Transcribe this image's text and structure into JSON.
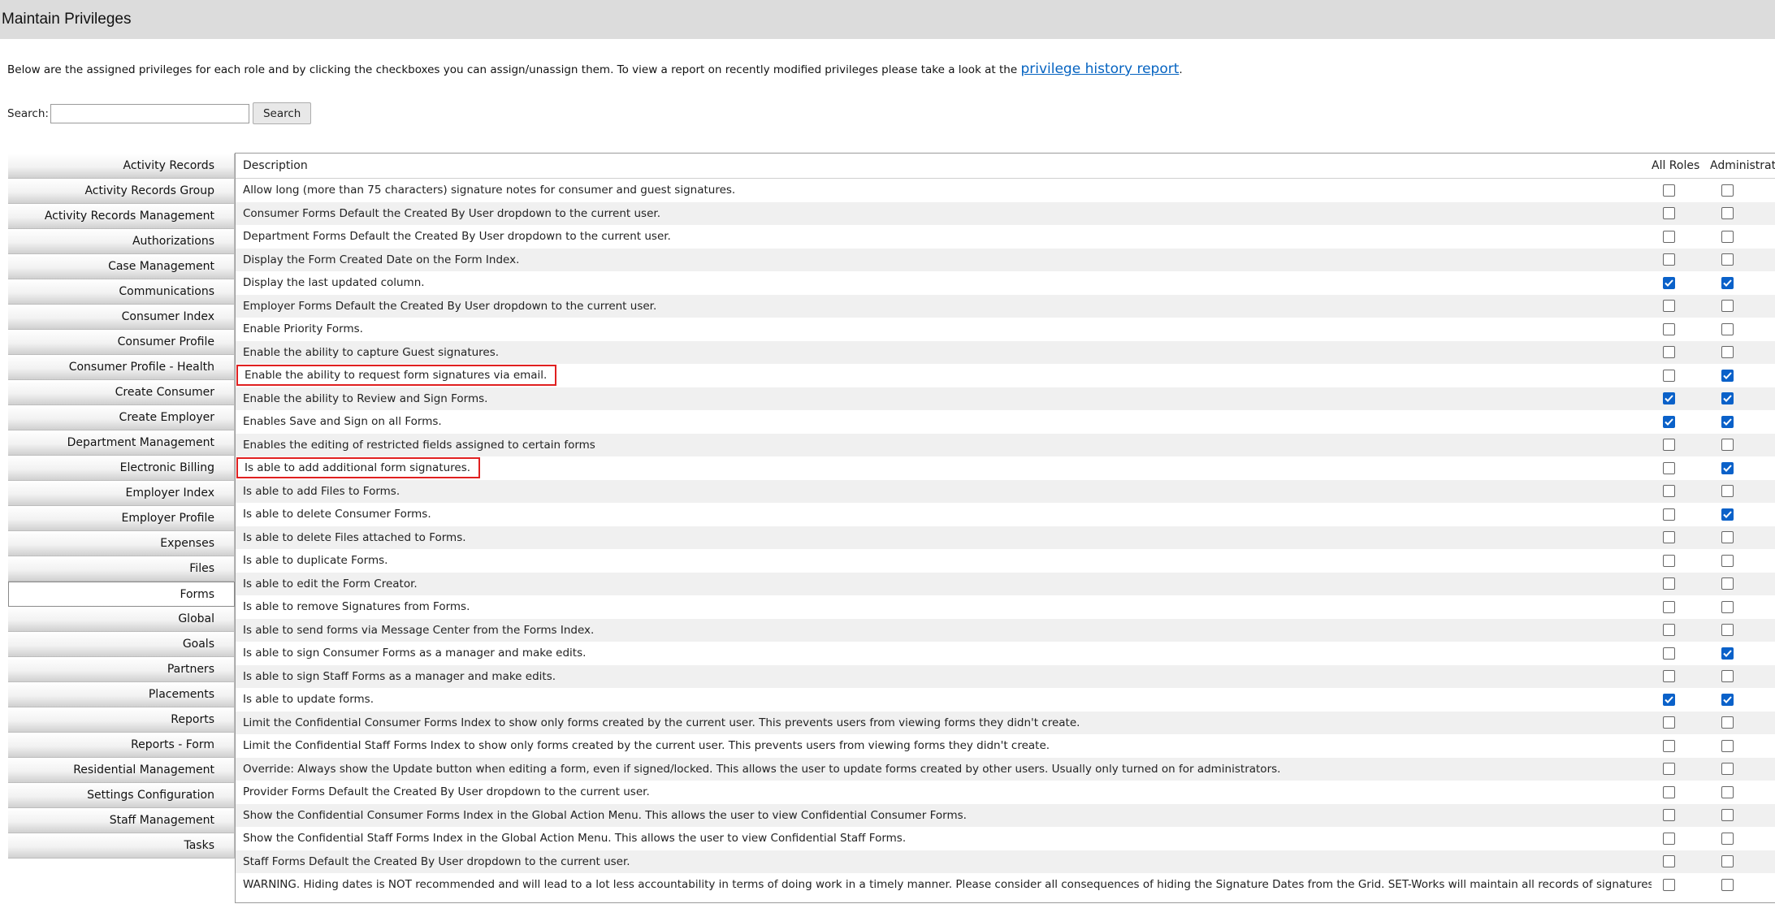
{
  "page": {
    "title": "Maintain Privileges",
    "intro_text": "Below are the assigned privileges for each role and by clicking the checkboxes you can assign/unassign them.   To view a report on recently modified privileges please take a look at the",
    "intro_link": "privilege history report",
    "intro_end": "."
  },
  "search": {
    "label": "Search:",
    "value": "",
    "button": "Search"
  },
  "sidebar": {
    "items": [
      {
        "label": "Activity Records"
      },
      {
        "label": "Activity Records Group"
      },
      {
        "label": "Activity Records Management"
      },
      {
        "label": "Authorizations"
      },
      {
        "label": "Case Management"
      },
      {
        "label": "Communications"
      },
      {
        "label": "Consumer Index"
      },
      {
        "label": "Consumer Profile"
      },
      {
        "label": "Consumer Profile - Health"
      },
      {
        "label": "Create Consumer"
      },
      {
        "label": "Create Employer"
      },
      {
        "label": "Department Management"
      },
      {
        "label": "Electronic Billing"
      },
      {
        "label": "Employer Index"
      },
      {
        "label": "Employer Profile"
      },
      {
        "label": "Expenses"
      },
      {
        "label": "Files"
      },
      {
        "label": "Forms",
        "active": true
      },
      {
        "label": "Global"
      },
      {
        "label": "Goals"
      },
      {
        "label": "Partners"
      },
      {
        "label": "Placements"
      },
      {
        "label": "Reports"
      },
      {
        "label": "Reports - Form"
      },
      {
        "label": "Residential Management"
      },
      {
        "label": "Settings Configuration"
      },
      {
        "label": "Staff Management"
      },
      {
        "label": "Tasks"
      }
    ]
  },
  "table": {
    "headers": {
      "description": "Description",
      "all_roles": "All Roles",
      "admin": "Administrato"
    },
    "rows": [
      {
        "desc": "Allow long (more than 75 characters) signature notes for consumer and guest signatures.",
        "all": false,
        "admin": false
      },
      {
        "desc": "Consumer Forms Default the Created By User dropdown to the current user.",
        "all": false,
        "admin": false
      },
      {
        "desc": "Department Forms Default the Created By User dropdown to the current user.",
        "all": false,
        "admin": false
      },
      {
        "desc": "Display the Form Created Date on the Form Index.",
        "all": false,
        "admin": false
      },
      {
        "desc": "Display the last updated column.",
        "all": true,
        "admin": true
      },
      {
        "desc": "Employer Forms Default the Created By User dropdown to the current user.",
        "all": false,
        "admin": false
      },
      {
        "desc": "Enable Priority Forms.",
        "all": false,
        "admin": false
      },
      {
        "desc": "Enable the ability to capture Guest signatures.",
        "all": false,
        "admin": false
      },
      {
        "desc": "Enable the ability to request form signatures via email.",
        "all": false,
        "admin": true,
        "highlight": true
      },
      {
        "desc": "Enable the ability to Review and Sign Forms.",
        "all": true,
        "admin": true
      },
      {
        "desc": "Enables Save and Sign on all Forms.",
        "all": true,
        "admin": true
      },
      {
        "desc": "Enables the editing of restricted fields assigned to certain forms",
        "all": false,
        "admin": false
      },
      {
        "desc": "Is able to add additional form signatures.",
        "all": false,
        "admin": true,
        "highlight": true
      },
      {
        "desc": "Is able to add Files to Forms.",
        "all": false,
        "admin": false
      },
      {
        "desc": "Is able to delete Consumer Forms.",
        "all": false,
        "admin": true
      },
      {
        "desc": "Is able to delete Files attached to Forms.",
        "all": false,
        "admin": false
      },
      {
        "desc": "Is able to duplicate Forms.",
        "all": false,
        "admin": false
      },
      {
        "desc": "Is able to edit the Form Creator.",
        "all": false,
        "admin": false
      },
      {
        "desc": "Is able to remove Signatures from Forms.",
        "all": false,
        "admin": false
      },
      {
        "desc": "Is able to send forms via Message Center from the Forms Index.",
        "all": false,
        "admin": false
      },
      {
        "desc": "Is able to sign Consumer Forms as a manager and make edits.",
        "all": false,
        "admin": true
      },
      {
        "desc": "Is able to sign Staff Forms as a manager and make edits.",
        "all": false,
        "admin": false
      },
      {
        "desc": "Is able to update forms.",
        "all": true,
        "admin": true
      },
      {
        "desc": "Limit the Confidential Consumer Forms Index to show only forms created by the current user. This prevents users from viewing forms they didn't create.",
        "all": false,
        "admin": false
      },
      {
        "desc": "Limit the Confidential Staff Forms Index to show only forms created by the current user. This prevents users from viewing forms they didn't create.",
        "all": false,
        "admin": false
      },
      {
        "desc": "Override: Always show the Update button when editing a form, even if signed/locked. This allows the user to update forms created by other users. Usually only turned on for administrators.",
        "all": false,
        "admin": false
      },
      {
        "desc": "Provider Forms Default the Created By User dropdown to the current user.",
        "all": false,
        "admin": false
      },
      {
        "desc": "Show the Confidential Consumer Forms Index in the Global Action Menu. This allows the user to view Confidential Consumer Forms.",
        "all": false,
        "admin": false
      },
      {
        "desc": "Show the Confidential Staff Forms Index in the Global Action Menu. This allows the user to view Confidential Staff Forms.",
        "all": false,
        "admin": false
      },
      {
        "desc": "Staff Forms Default the Created By User dropdown to the current user.",
        "all": false,
        "admin": false
      },
      {
        "desc": "WARNING. Hiding dates is NOT recommended and will lead to a lot less accountability in terms of doing work in a timely manner. Please consider all consequences of hiding the Signature Dates from the Grid. SET-Works will maintain all records of signatures and dates.",
        "all": false,
        "admin": false
      }
    ]
  },
  "colors": {
    "checkbox_on": "#0a61c9",
    "highlight_box": "#e02020",
    "link": "#0563c1",
    "titlebar": "#dcdcdc"
  }
}
